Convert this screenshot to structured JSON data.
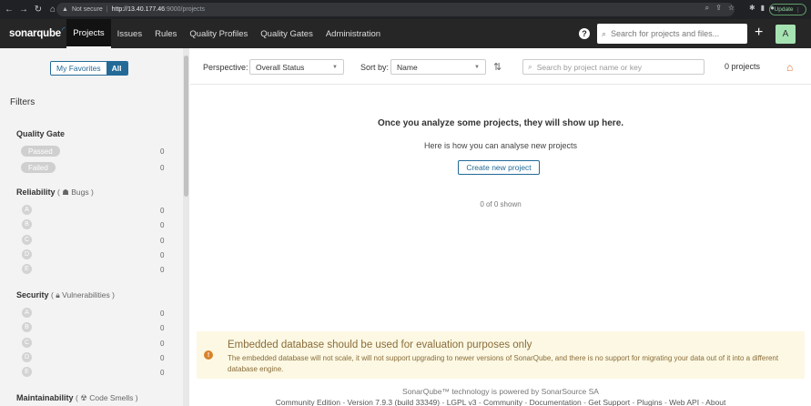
{
  "browser": {
    "url_warning": "Not secure",
    "url_host": "http://13.40.177.46",
    "url_path": ":9000/projects",
    "update_label": "Update"
  },
  "nav": {
    "logo": "sonarqube",
    "items": [
      {
        "label": "Projects",
        "active": true
      },
      {
        "label": "Issues"
      },
      {
        "label": "Rules"
      },
      {
        "label": "Quality Profiles"
      },
      {
        "label": "Quality Gates"
      },
      {
        "label": "Administration"
      }
    ],
    "search_placeholder": "Search for projects and files...",
    "avatar_letter": "A",
    "help": "?"
  },
  "sidebar": {
    "toggle": {
      "favorites": "My Favorites",
      "all": "All"
    },
    "filters_title": "Filters",
    "quality_gate": {
      "title": "Quality Gate",
      "options": [
        {
          "label": "Passed",
          "count": "0"
        },
        {
          "label": "Failed",
          "count": "0"
        }
      ]
    },
    "reliability": {
      "title": "Reliability",
      "sub": "Bugs",
      "grades": [
        {
          "label": "A",
          "count": "0"
        },
        {
          "label": "B",
          "count": "0"
        },
        {
          "label": "C",
          "count": "0"
        },
        {
          "label": "D",
          "count": "0"
        },
        {
          "label": "E",
          "count": "0"
        }
      ]
    },
    "security": {
      "title": "Security",
      "sub": "Vulnerabilities",
      "grades": [
        {
          "label": "A",
          "count": "0"
        },
        {
          "label": "B",
          "count": "0"
        },
        {
          "label": "C",
          "count": "0"
        },
        {
          "label": "D",
          "count": "0"
        },
        {
          "label": "E",
          "count": "0"
        }
      ]
    },
    "maintainability": {
      "title": "Maintainability",
      "sub": "Code Smells"
    }
  },
  "toolbar": {
    "perspective_label": "Perspective:",
    "perspective_value": "Overall Status",
    "sort_label": "Sort by:",
    "sort_value": "Name",
    "search_placeholder": "Search by project name or key",
    "project_count": "0 projects"
  },
  "main": {
    "empty_title": "Once you analyze some projects, they will show up here.",
    "empty_sub": "Here is how you can analyse new projects",
    "create_button": "Create new project",
    "shown": "0 of 0 shown"
  },
  "warning": {
    "title": "Embedded database should be used for evaluation purposes only",
    "text": "The embedded database will not scale, it will not support upgrading to newer versions of SonarQube, and there is no support for migrating your data out of it into a different database engine."
  },
  "footer": {
    "powered": "SonarQube™ technology is powered by SonarSource SA",
    "edition": "Community Edition",
    "version": "Version 7.9.3 (build 33349)",
    "links": [
      "LGPL v3",
      "Community",
      "Documentation",
      "Get Support",
      "Plugins",
      "Web API",
      "About"
    ]
  }
}
